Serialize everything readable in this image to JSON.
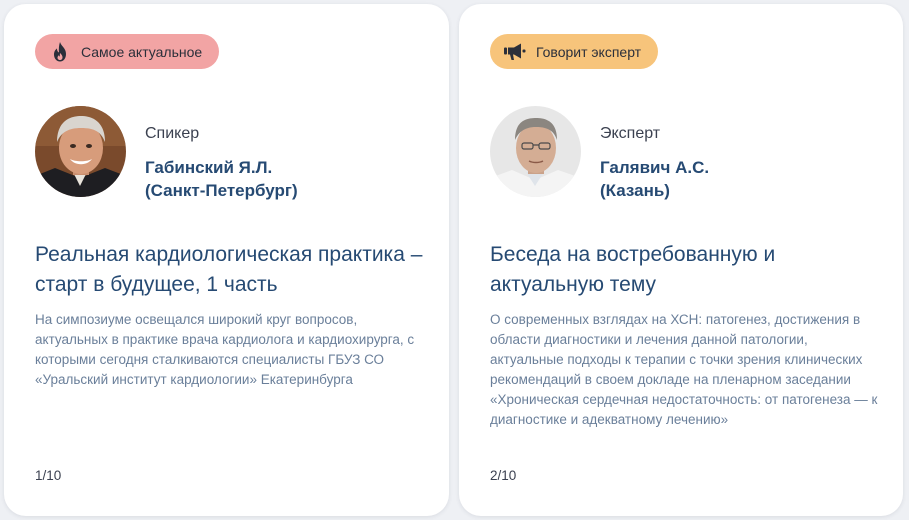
{
  "cards": [
    {
      "badge": {
        "label": "Самое актуальное",
        "icon": "flame-icon",
        "color": "#f2a4a4"
      },
      "speaker": {
        "role": "Спикер",
        "name_line1": "Габинский Я.Л.",
        "name_line2": "(Санкт-Петербург)"
      },
      "title": "Реальная кардиологическая практика – старт в будущее, 1 часть",
      "description": "На симпозиуме освещался широкий круг вопросов, актуальных в практике врача кардиолога и кардиохирурга, с которыми сегодня сталкиваются специалисты ГБУЗ СО «Уральский институт кардиологии» Екатеринбурга",
      "counter": "1/10"
    },
    {
      "badge": {
        "label": "Говорит эксперт",
        "icon": "megaphone-icon",
        "color": "#f7c47b"
      },
      "speaker": {
        "role": "Эксперт",
        "name_line1": "Галявич А.С.",
        "name_line2": "(Казань)"
      },
      "title": "Беседа на востребованную и актуальную тему",
      "description": "О современных взглядах на ХСН: патогенез, достижения в области диагностики и лечения данной патологии, актуальные подходы к терапии с точки зрения клинических рекомендаций в своем докладе на пленарном заседании «Хроническая сердечная недостаточность: от патогенеза — к диагностике и адекватному лечению»",
      "counter": "2/10"
    }
  ]
}
